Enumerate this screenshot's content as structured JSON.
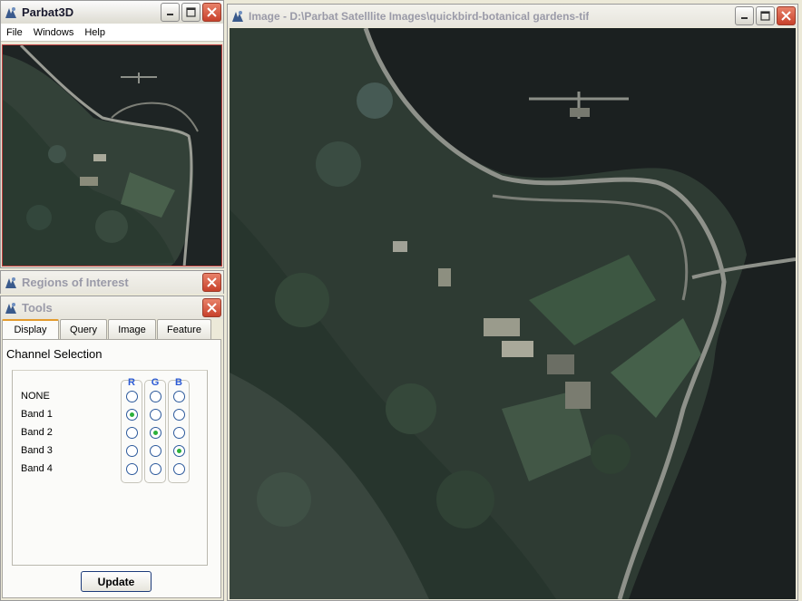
{
  "parbat_window": {
    "title": "Parbat3D",
    "menu": [
      "File",
      "Windows",
      "Help"
    ]
  },
  "roi_window": {
    "title": "Regions of Interest"
  },
  "tools_window": {
    "title": "Tools",
    "tabs": [
      "Display",
      "Query",
      "Image",
      "Feature"
    ],
    "selected_tab": "Display",
    "channel_selection": {
      "heading": "Channel Selection",
      "columns": [
        "R",
        "G",
        "B"
      ],
      "rows": [
        "NONE",
        "Band 1",
        "Band 2",
        "Band 3",
        "Band 4"
      ],
      "selected": {
        "R": "Band 1",
        "G": "Band 2",
        "B": "Band 3"
      }
    },
    "update_label": "Update"
  },
  "image_window": {
    "title": "Image - D:\\Parbat Satelllite Images\\quickbird-botanical gardens-tif"
  },
  "colors": {
    "close_button": "#c8412b",
    "tab_highlight": "#e39b2e",
    "radio_dot": "#2bb03a",
    "column_header": "#2b5ad4"
  }
}
